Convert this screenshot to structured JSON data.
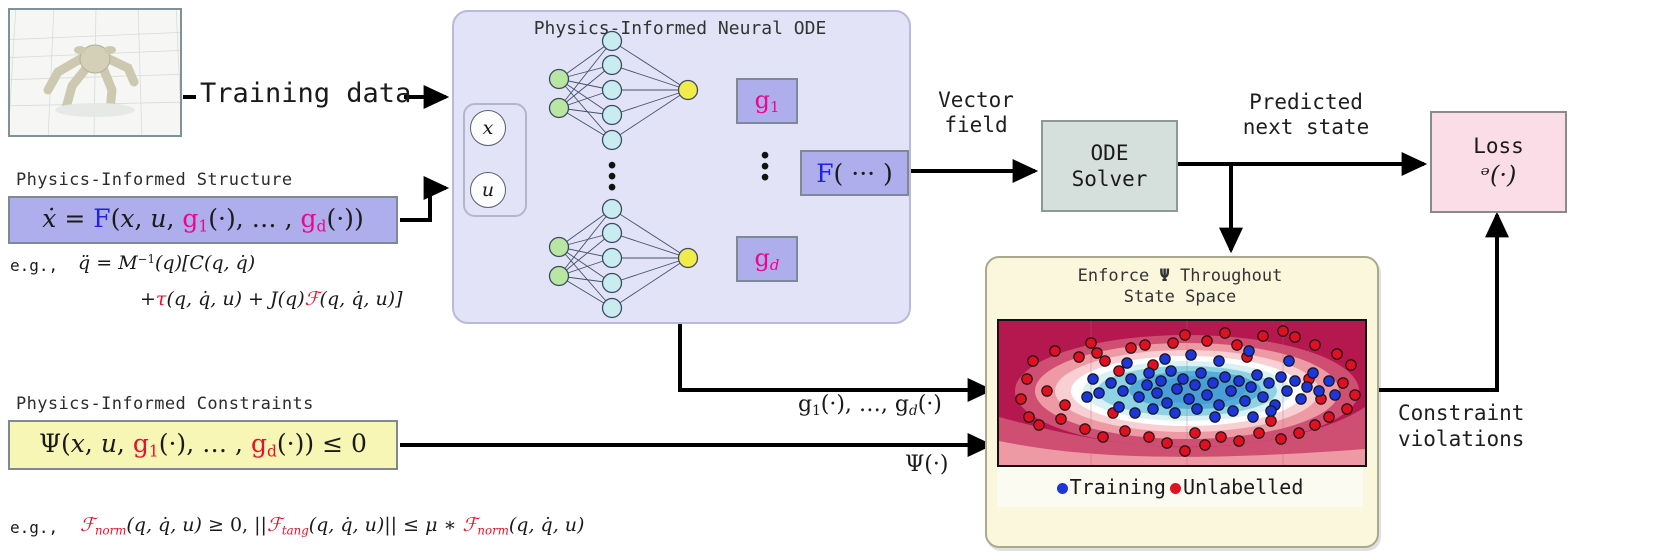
{
  "figure": {
    "thumbnail": {
      "name": "ant-robot-simulation",
      "alt": "MuJoCo Ant robot standing on a grid plane"
    },
    "training_data_label": "Training data"
  },
  "structure_block": {
    "title": "Physics-Informed Structure",
    "equation_plain": "ẋ = F(x, u, g₁(·), …, g_d(·))",
    "eq_lhs": "ẋ",
    "eq_eq": "=",
    "eq_F": "F",
    "eq_open": "(",
    "eq_x": "x",
    "eq_comma1": ",",
    "eq_u": "u",
    "eq_comma2": ",",
    "eq_g1": "g",
    "eq_g1sub": "1",
    "eq_dot1": "(·)",
    "eq_ellipsis": ", … ,",
    "eq_gd": "g",
    "eq_gdsub": "d",
    "eq_dot2": "(·)",
    "eq_close": ")",
    "example_prefix": "e.g.,",
    "example_line1_plain": "q̈ = M⁻¹(q)[C(q, q̇)",
    "example_line2_plain": "+ τ(q, q̇, u) + J(q)F(q, q̇, u)]",
    "ex_qddot": "q̈",
    "ex_eq": "=",
    "ex_M": "M",
    "ex_Msup": "−1",
    "ex_q1": "(q)[",
    "ex_C": "C(q, q̇)",
    "ex_plus": "+",
    "ex_tau": "τ",
    "ex_tauargs": "(q, q̇, u)",
    "ex_plus2": "+",
    "ex_J": "J(q)",
    "ex_Fcal": "ℱ",
    "ex_Fargs": "(q, q̇, u)]"
  },
  "constraints_block": {
    "title": "Physics-Informed Constraints",
    "equation_plain": "Ψ(x, u, g₁(·), …, g_d(·)) ≤ 0",
    "eq_psi": "Ψ",
    "eq_open": "(",
    "eq_x": "x",
    "eq_comma1": ",",
    "eq_u": "u",
    "eq_comma2": ",",
    "eq_g1": "g",
    "eq_g1sub": "1",
    "eq_dot1": "(·)",
    "eq_ellipsis": ", … ,",
    "eq_gd": "g",
    "eq_gdsub": "d",
    "eq_dot2": "(·)",
    "eq_close": ")",
    "eq_leq": "≤ 0",
    "example_prefix": "e.g.,",
    "example_plain": "F_norm(q, q̇, u) ≥ 0,  ||F_tang(q, q̇, u)|| ≤ μ * F_norm(q, q̇, u)",
    "ex_F1": "ℱ",
    "ex_F1sub": "norm",
    "ex_F1args": "(q, q̇, u)",
    "ex_geq": "≥ 0,",
    "ex_norm_open": "||",
    "ex_F2": "ℱ",
    "ex_F2sub": "tang",
    "ex_F2args": "(q, q̇, u)",
    "ex_norm_close": "||",
    "ex_leq": "≤",
    "ex_mu": "μ",
    "ex_star": "∗",
    "ex_F3": "ℱ",
    "ex_F3sub": "norm",
    "ex_F3args": "(q, q̇, u)"
  },
  "pinode": {
    "title": "Physics-Informed Neural ODE",
    "input_x": "x",
    "input_u": "u",
    "g_first_label": "g",
    "g_first_sub": "1",
    "g_last_label": "g",
    "g_last_sub": "d",
    "F_label": "F",
    "F_args": "( ··· )",
    "vertical_dots": "⋮",
    "network_top": {
      "input_nodes": 2,
      "hidden_nodes": 5,
      "output_nodes": 1
    },
    "network_bottom": {
      "input_nodes": 2,
      "hidden_nodes": 5,
      "output_nodes": 1
    },
    "colors": {
      "panel_bg": "#e3e3f7",
      "input_node": "#b9e6a0",
      "hidden_node": "#c8ecf0",
      "output_node": "#f2ec4a",
      "g_box": "#aeaeec",
      "g_text": "#f0048c",
      "F_text": "#2222dd"
    }
  },
  "flow": {
    "vector_field_line1": "Vector",
    "vector_field_line2": "field",
    "ode_solver_line1": "ODE",
    "ode_solver_line2": "Solver",
    "predicted_line1": "Predicted",
    "predicted_line2": "next state",
    "loss_line1": "Loss",
    "loss_line2": "ᵊ(·)",
    "g_outputs_label_plain": "g₁(·), …, g_d(·)",
    "g_out_g": "g",
    "g_out_sub1": "1",
    "g_out_dot1": "(·), …,",
    "g_out_g2": "g",
    "g_out_sub2": "d",
    "g_out_dot2": "(·)",
    "psi_label": "Ψ(·)",
    "violations_line1": "Constraint",
    "violations_line2": "violations"
  },
  "enforce": {
    "title_line1_pre": "Enforce ",
    "title_psi": "Ψ",
    "title_line1_post": " Throughout",
    "title_line2": "State Space",
    "legend": [
      {
        "label": "Training",
        "color": "#1c36d8"
      },
      {
        "label": "Unlabelled",
        "color": "#e01020"
      }
    ],
    "contour": {
      "type": "filled-contour",
      "bands": [
        "#b5174f",
        "#cf4f73",
        "#ee9aa4",
        "#f8cfd2",
        "#ffffff",
        "#d9f1f5",
        "#8ed3e3",
        "#53aedc",
        "#4a9ed8"
      ],
      "description": "Elliptical nested contour bands, safe blue core at center, violation crimson at edges"
    }
  },
  "colors": {
    "structure_box_bg": "#aeaeec",
    "constraint_box_bg": "#f7f6b5",
    "ode_box_bg": "#d5e0dc",
    "loss_box_bg": "#fadde6",
    "enforce_panel_bg": "#faf7dd",
    "accent_red": "#e8112d",
    "accent_magenta": "#f0048c",
    "accent_blue": "#2222dd"
  }
}
